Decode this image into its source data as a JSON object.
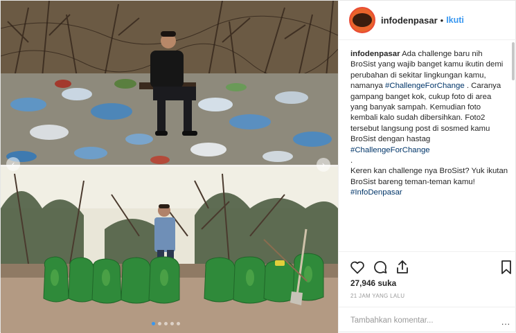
{
  "header": {
    "username": "infodenpasar",
    "separator": "•",
    "follow_label": "Ikuti"
  },
  "caption": {
    "username": "infodenpasar",
    "text_1": " Ada challenge baru nih BroSist yang wajib banget kamu ikutin demi perubahan di sekitar lingkungan kamu, namanya ",
    "tag_1": "#ChallengeForChange",
    "text_2": " . Caranya gampang banget kok, cukup foto di area yang banyak sampah. Kemudian foto kembali kalo sudah dibersihkan. Foto2 tersebut langsung post di sosmed kamu BroSist dengan hastag ",
    "tag_2": "#ChallengeForChange",
    "line_dot": ".",
    "text_3": "Keren kan challenge nya BroSist? Yuk ikutan BroSist bareng teman-teman kamu! ",
    "tag_3": "#InfoDenpasar"
  },
  "stats": {
    "likes": "27,946 suka",
    "time": "21 JAM YANG LALU"
  },
  "comment": {
    "placeholder": "Tambahkan komentar...",
    "more": "..."
  },
  "icons": {
    "like": "heart-icon",
    "comment": "comment-icon",
    "share": "share-icon",
    "save": "bookmark-icon",
    "nav_prev": "chevron-left-icon",
    "nav_next": "chevron-right-icon"
  },
  "colors": {
    "link": "#3897f0",
    "hashtag": "#003569",
    "avatar_ring": "#e94b35",
    "bag_green": "#2f8a3a"
  }
}
